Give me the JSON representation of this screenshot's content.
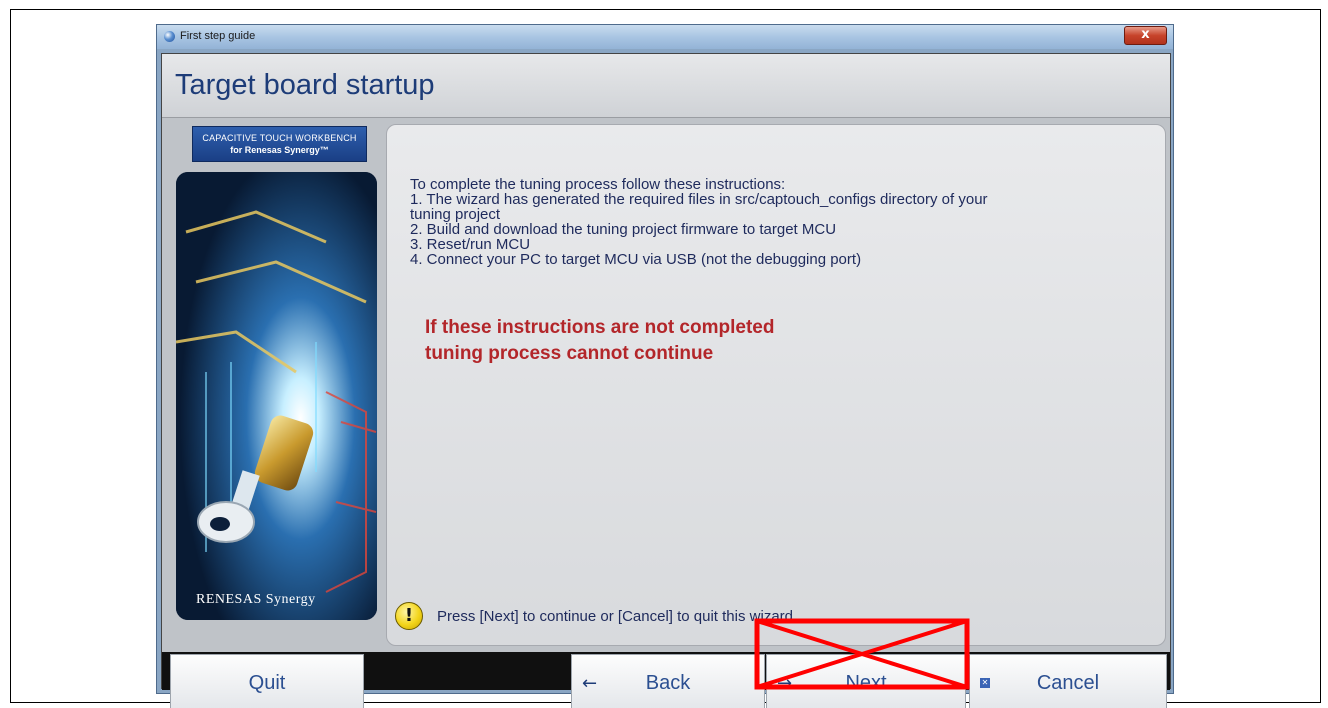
{
  "window": {
    "title": "First step guide",
    "close_glyph": "x"
  },
  "page": {
    "title": "Target board startup"
  },
  "banner": {
    "line1": "CAPACITIVE TOUCH WORKBENCH",
    "line2": "for Renesas Synergy™"
  },
  "brand": {
    "text": "RENESAS Synergy"
  },
  "instructions": {
    "lines": [
      "To complete the tuning process follow these instructions:",
      "1. The wizard has generated the required files in src/captouch_configs directory of your",
      "tuning project",
      "2. Build and download the tuning project firmware to target MCU",
      "3. Reset/run MCU",
      "4. Connect your PC to target MCU via USB (not the debugging port)"
    ],
    "warning_line1": "If these instructions are not completed",
    "warning_line2": "tuning process cannot continue"
  },
  "hint": {
    "icon_glyph": "!",
    "text": "Press [Next] to continue or [Cancel] to quit this wizard."
  },
  "buttons": {
    "quit": "Quit",
    "back": "Back",
    "next": "Next",
    "cancel": "Cancel",
    "back_icon": "←",
    "next_icon": "→",
    "cancel_icon": "✕"
  },
  "colors": {
    "title": "#1d3c78",
    "warning": "#b3262a",
    "annotation": "#ff0000"
  },
  "icons": [
    "app-globe-icon",
    "close-icon",
    "warning-icon",
    "back-arrow-icon",
    "next-arrow-icon",
    "cancel-x-icon"
  ]
}
